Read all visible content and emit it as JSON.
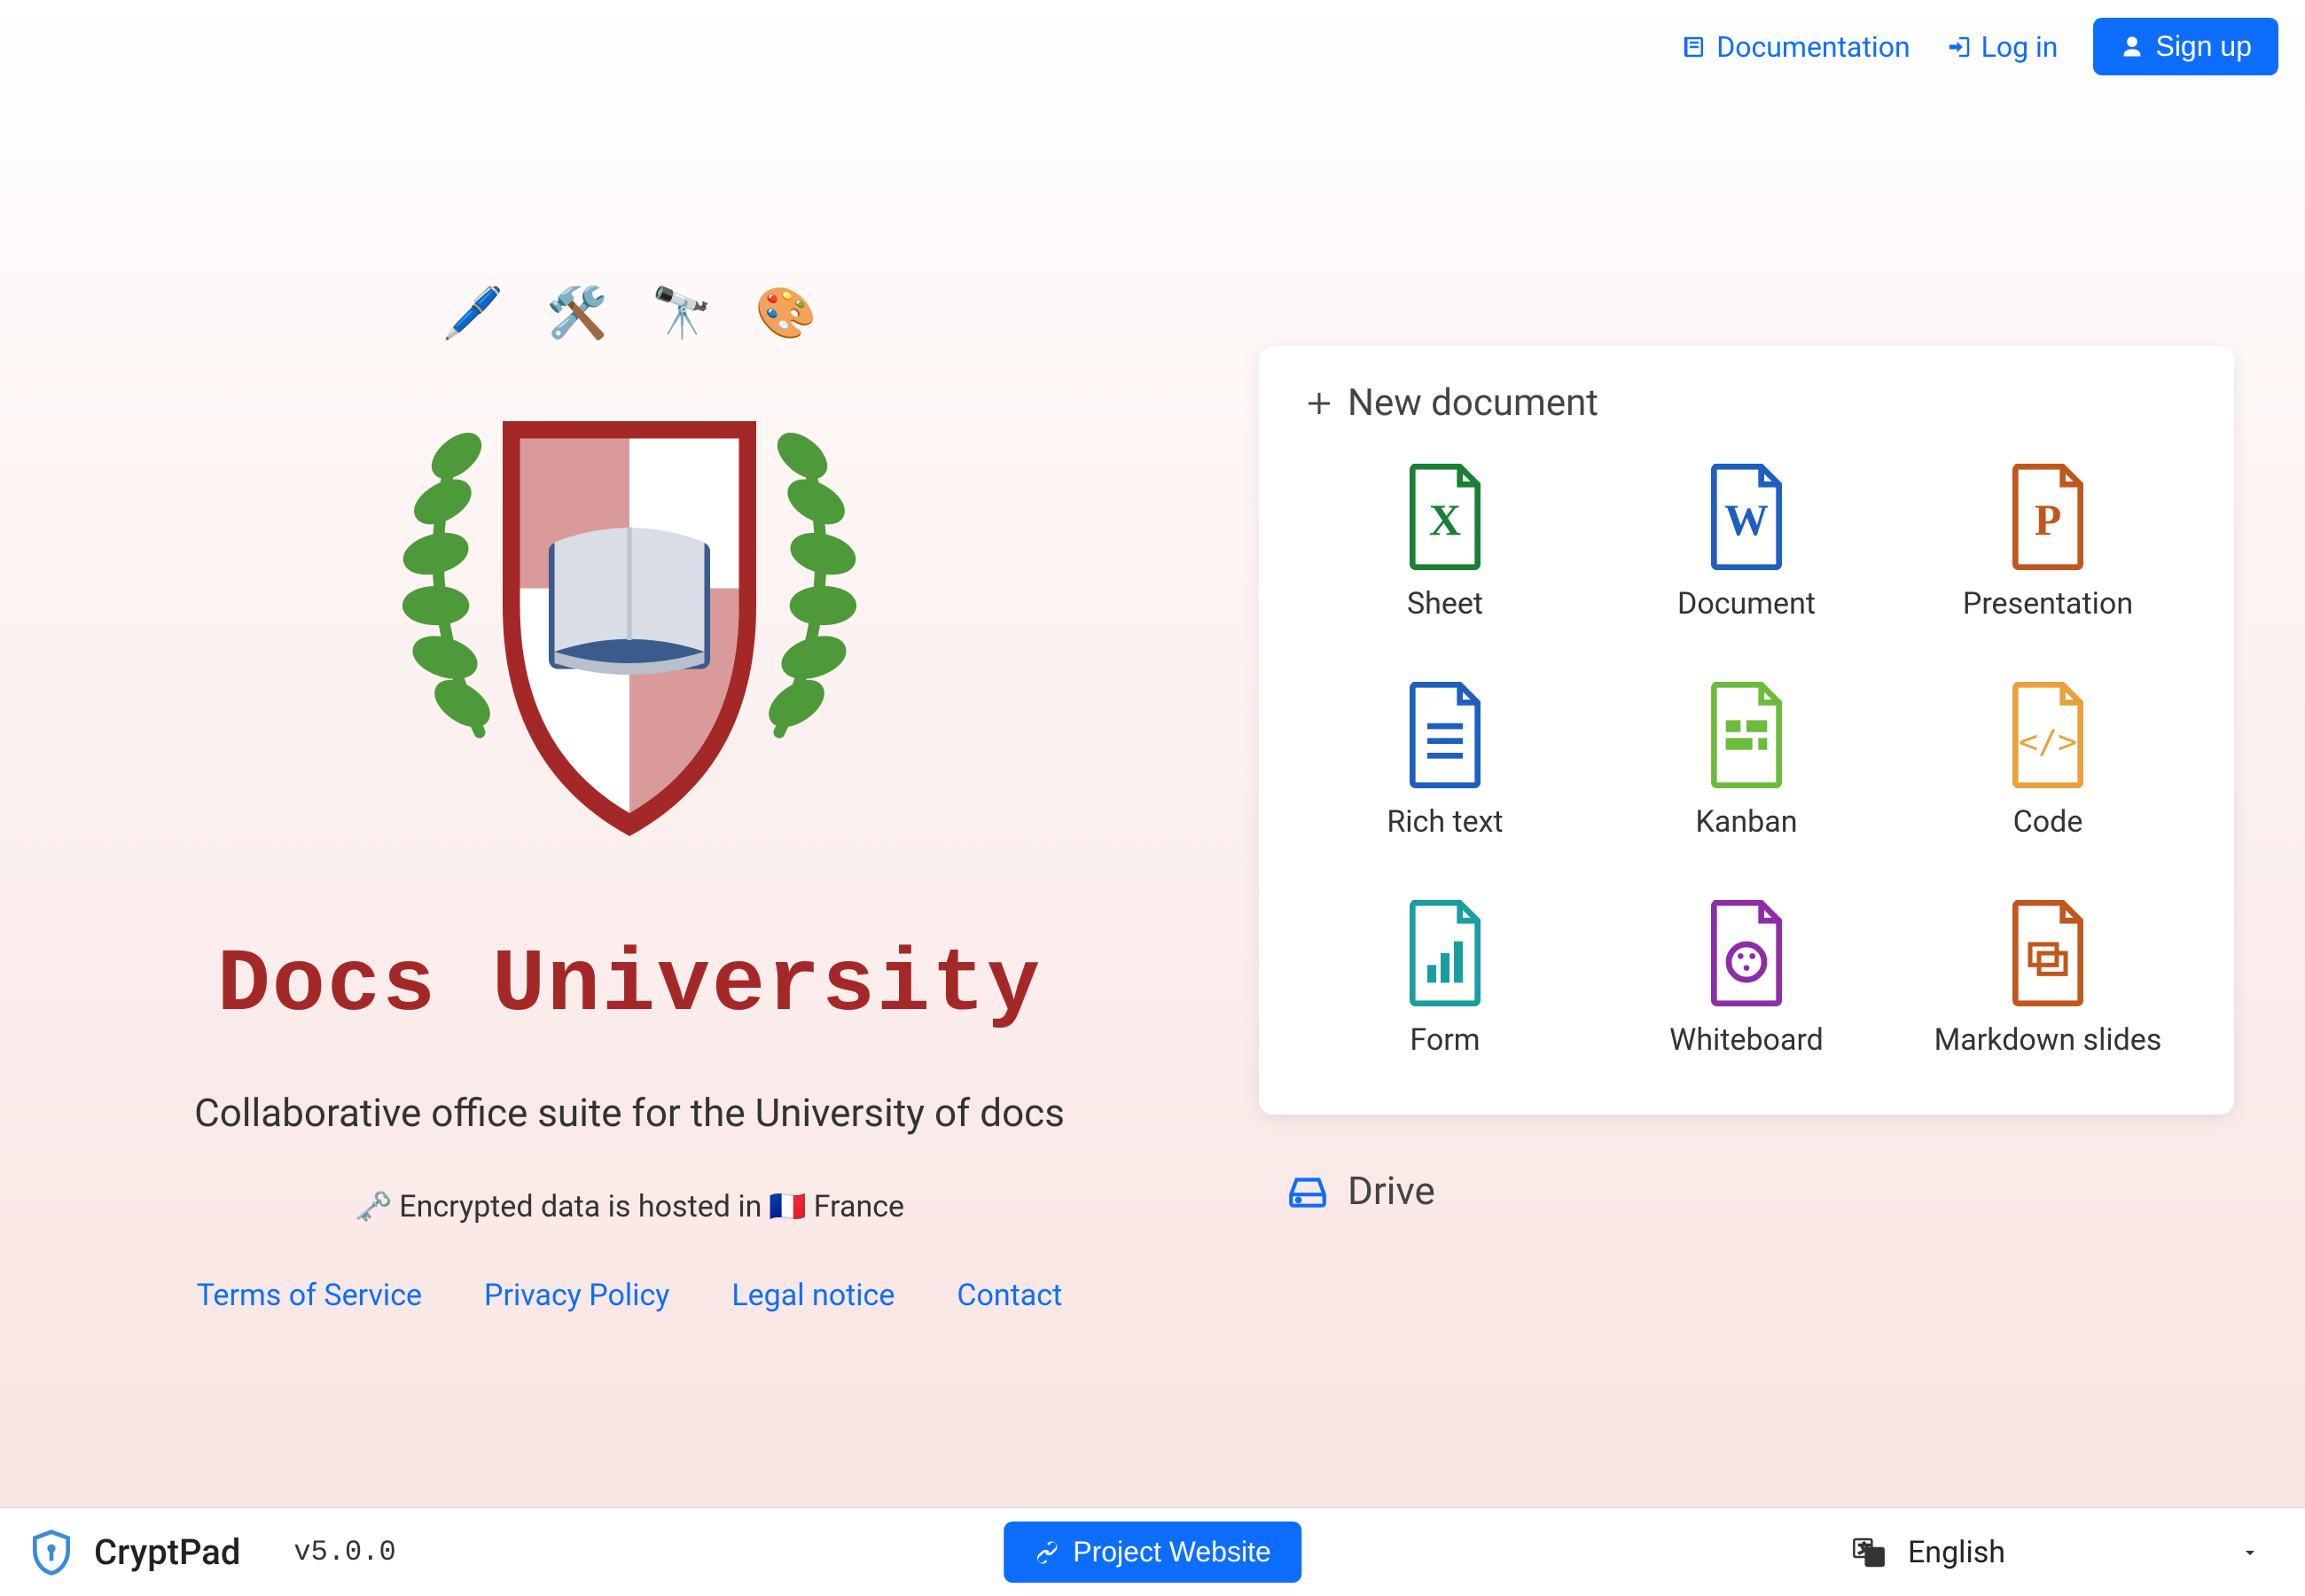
{
  "header": {
    "documentation": "Documentation",
    "login": "Log in",
    "signup": "Sign up"
  },
  "site": {
    "title": "Docs University",
    "tagline": "Collaborative office suite for the University of docs",
    "hosting_prefix": "Encrypted data is hosted in",
    "hosting_country": "France"
  },
  "legal": {
    "tos": "Terms of Service",
    "privacy": "Privacy Policy",
    "legal_notice": "Legal notice",
    "contact": "Contact"
  },
  "panel": {
    "title": "New document",
    "items": [
      {
        "label": "Sheet",
        "color": "#1a7f37",
        "letter": "X"
      },
      {
        "label": "Document",
        "color": "#1f5fbf",
        "letter": "W"
      },
      {
        "label": "Presentation",
        "color": "#c1571d",
        "letter": "P"
      },
      {
        "label": "Rich text",
        "color": "#1f5fbf",
        "glyph": "lines"
      },
      {
        "label": "Kanban",
        "color": "#6cbb3c",
        "glyph": "kanban"
      },
      {
        "label": "Code",
        "color": "#e9a13b",
        "glyph": "code"
      },
      {
        "label": "Form",
        "color": "#1a9e9e",
        "glyph": "bars"
      },
      {
        "label": "Whiteboard",
        "color": "#8e2da8",
        "glyph": "palette"
      },
      {
        "label": "Markdown slides",
        "color": "#c1571d",
        "glyph": "slides"
      }
    ]
  },
  "drive": {
    "label": "Drive"
  },
  "footer": {
    "brand": "CryptPad",
    "version": "v5.0.0",
    "project_website": "Project Website",
    "language": "English"
  }
}
